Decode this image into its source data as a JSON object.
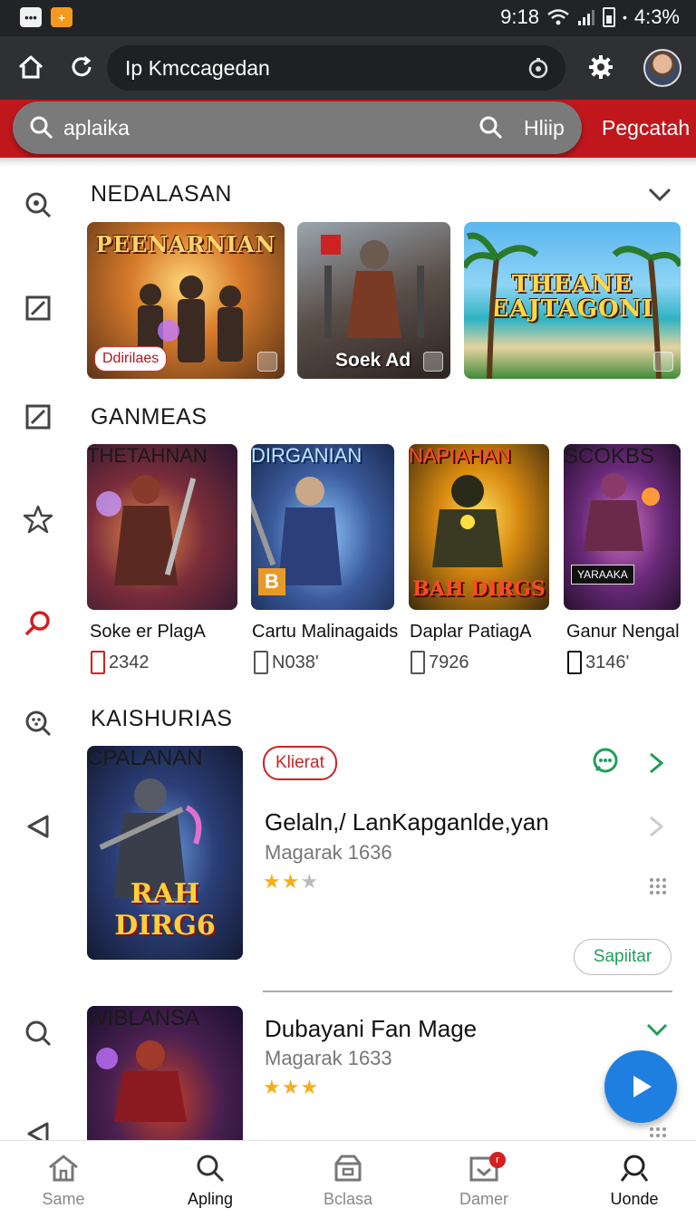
{
  "status_bar": {
    "time": "4:3%",
    "signal_text": "9:18"
  },
  "browser": {
    "url": "Ip Kmccagedan"
  },
  "search": {
    "query": "aplaika",
    "help_label": "Hliip",
    "action_label": "Pegcatah"
  },
  "sections": {
    "featured": {
      "title": "NEDALASAN",
      "tiles": [
        {
          "title": "PEENARNIAN",
          "badge": "Ddirilaes"
        },
        {
          "caption": "Soek Ad"
        },
        {
          "title": "THEANE EAJTAGONI"
        }
      ]
    },
    "games": {
      "title": "GANMEAS",
      "items": [
        {
          "art_title": "THETAHNAN",
          "name": "Soke er PlagA",
          "count": "2342",
          "tag": ""
        },
        {
          "art_title": "DIRGANIAN",
          "name": "Cartu Malinagaids",
          "count": "N038'",
          "tag": "B"
        },
        {
          "art_title": "NAPIAHAN",
          "name": "Daplar PatiagA",
          "count": "7926",
          "tag": "BAH DIRGS"
        },
        {
          "art_title": "SCOKBS",
          "name": "Ganur Nengal",
          "count": "3146'",
          "tag": "YARAAKA"
        }
      ]
    },
    "categories": {
      "title": "KAISHURIAS",
      "items": [
        {
          "art_title": "CPALANAN",
          "art_subtitle": "RAH DIRG6",
          "badge": "Klierat",
          "title": "Gelaln,/ LanKapganlde,yan",
          "sub": "Magarak 1636",
          "rating": 2,
          "button": "Sapiitar"
        },
        {
          "art_title": "WIBLANSA",
          "title": "Dubayani Fan Mage",
          "sub": "Magarak 1633",
          "rating": 3
        }
      ]
    }
  },
  "bottom_nav": [
    {
      "label": "Same",
      "icon": "home-icon"
    },
    {
      "label": "Apling",
      "icon": "search-icon"
    },
    {
      "label": "Bclasa",
      "icon": "store-icon"
    },
    {
      "label": "Damer",
      "icon": "inbox-icon",
      "badge": "r"
    },
    {
      "label": "Uonde",
      "icon": "account-icon"
    }
  ],
  "colors": {
    "accent_red": "#c0171d",
    "fab_blue": "#1e7fe0",
    "green": "#1f9e5a",
    "star": "#f2b01e"
  }
}
